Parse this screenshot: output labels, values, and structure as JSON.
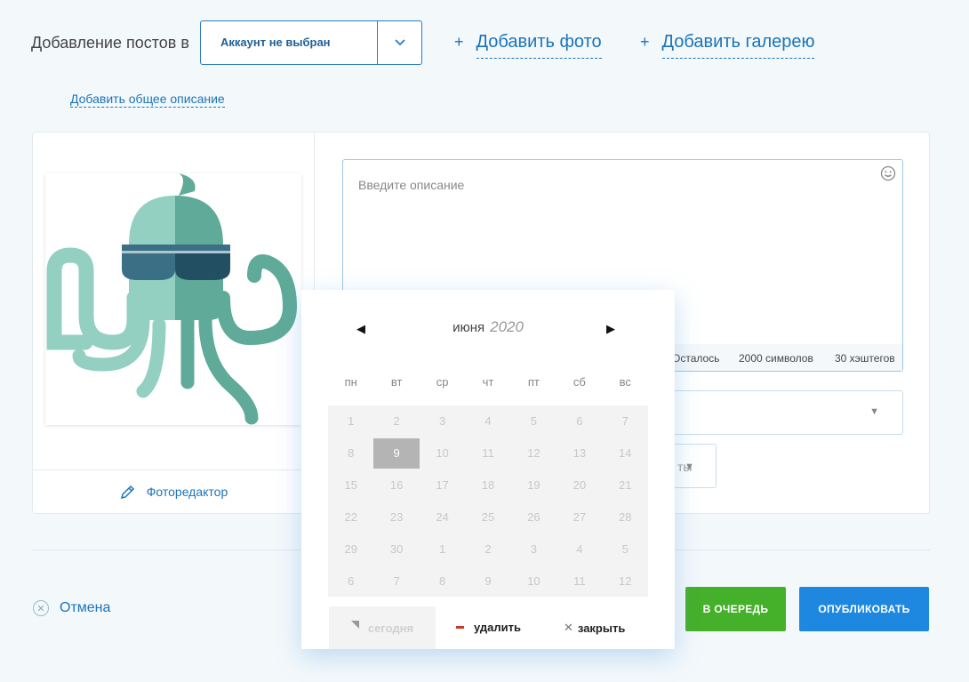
{
  "header": {
    "title": "Добавление постов в",
    "account_select": "Аккаунт не выбран",
    "add_photo": "Добавить фото",
    "add_gallery": "Добавить галерею",
    "plus": "+"
  },
  "add_description": "Добавить общее описание",
  "photo_panel": {
    "editor_label": "Фоторедактор"
  },
  "description": {
    "placeholder": "Введите описание",
    "remaining": "Осталось",
    "chars": "2000 символов",
    "hashtags": "30 хэштегов"
  },
  "select3_text": "ты",
  "calendar": {
    "prev": "◀",
    "next": "▶",
    "month": "июня",
    "year": "2020",
    "weekdays": [
      "пн",
      "вт",
      "ср",
      "чт",
      "пт",
      "сб",
      "вс"
    ],
    "days": [
      "1",
      "2",
      "3",
      "4",
      "5",
      "6",
      "7",
      "8",
      "9",
      "10",
      "11",
      "12",
      "13",
      "14",
      "15",
      "16",
      "17",
      "18",
      "19",
      "20",
      "21",
      "22",
      "23",
      "24",
      "25",
      "26",
      "27",
      "28",
      "29",
      "30",
      "1",
      "2",
      "3",
      "4",
      "5",
      "6",
      "7",
      "8",
      "9",
      "10",
      "11",
      "12"
    ],
    "selected_index": 8,
    "today_label": "сегодня",
    "delete_label": "удалить",
    "close_label": "закрыть",
    "close_glyph": "✕"
  },
  "footer": {
    "cancel": "Отмена",
    "cancel_glyph": "✕",
    "queue": "В ОЧЕРЕДЬ",
    "publish": "ОПУБЛИКОВАТЬ"
  },
  "colors": {
    "accent_blue": "#1c74b8",
    "queue_green": "#45b02a",
    "publish_blue": "#1e88e0"
  },
  "icons": [
    "chevron-down-icon",
    "pencil-icon",
    "smiley-icon",
    "cancel-circle-icon",
    "octopus-logo"
  ]
}
